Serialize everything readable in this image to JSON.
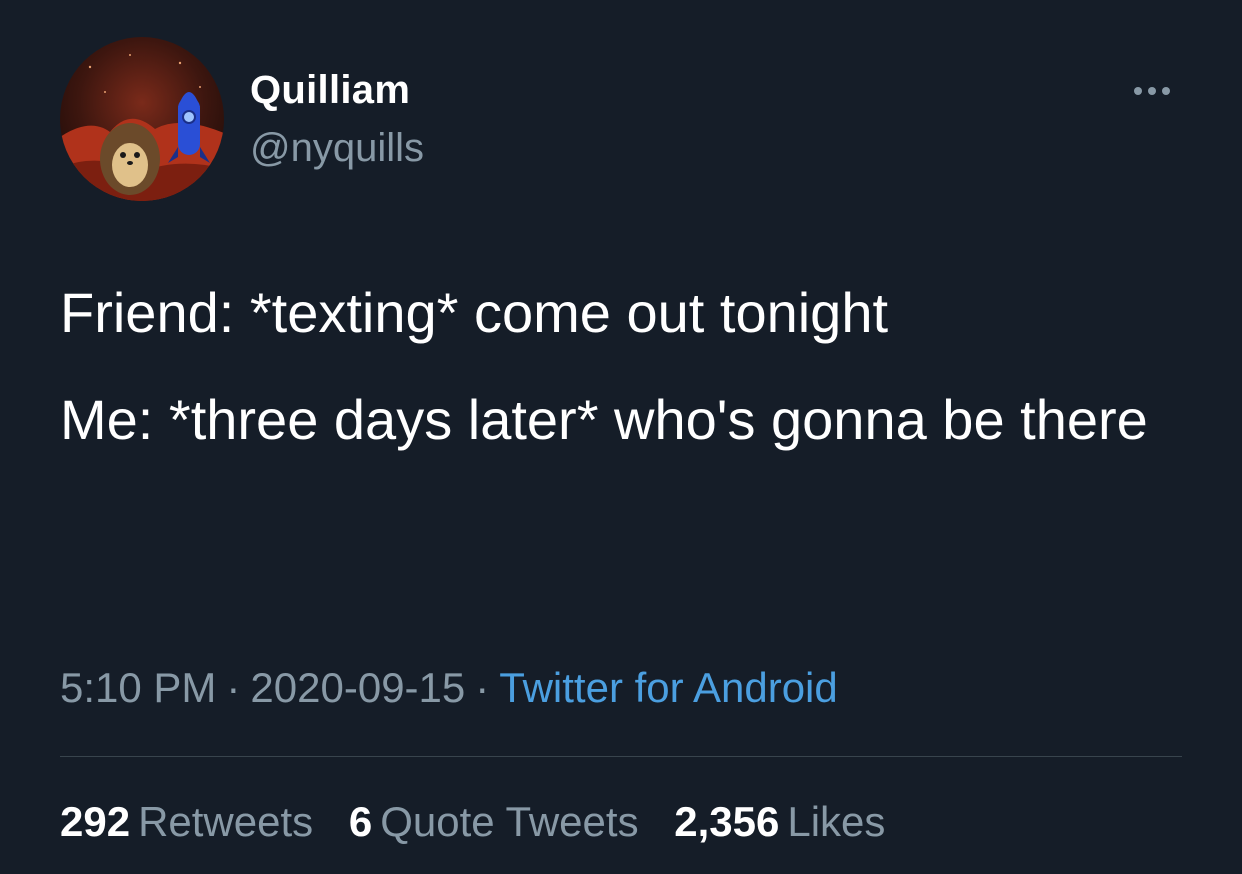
{
  "author": {
    "display_name": "Quilliam",
    "handle": "@nyquills"
  },
  "tweet": {
    "line1": "Friend: *texting* come out tonight",
    "line2": "Me: *three days later* who's gonna be there"
  },
  "meta": {
    "time": "5:10 PM",
    "separator": "·",
    "date": "2020-09-15",
    "source": "Twitter for Android"
  },
  "stats": {
    "retweets_count": "292",
    "retweets_label": "Retweets",
    "quotes_count": "6",
    "quotes_label": "Quote Tweets",
    "likes_count": "2,356",
    "likes_label": "Likes"
  },
  "icons": {
    "more": "more-horizontal-icon",
    "avatar": "hedgehog-rocket-avatar"
  },
  "colors": {
    "background": "#151d28",
    "primary_text": "#ffffff",
    "secondary_text": "#8899a6",
    "link": "#4b9fe0",
    "divider": "#38444d"
  }
}
